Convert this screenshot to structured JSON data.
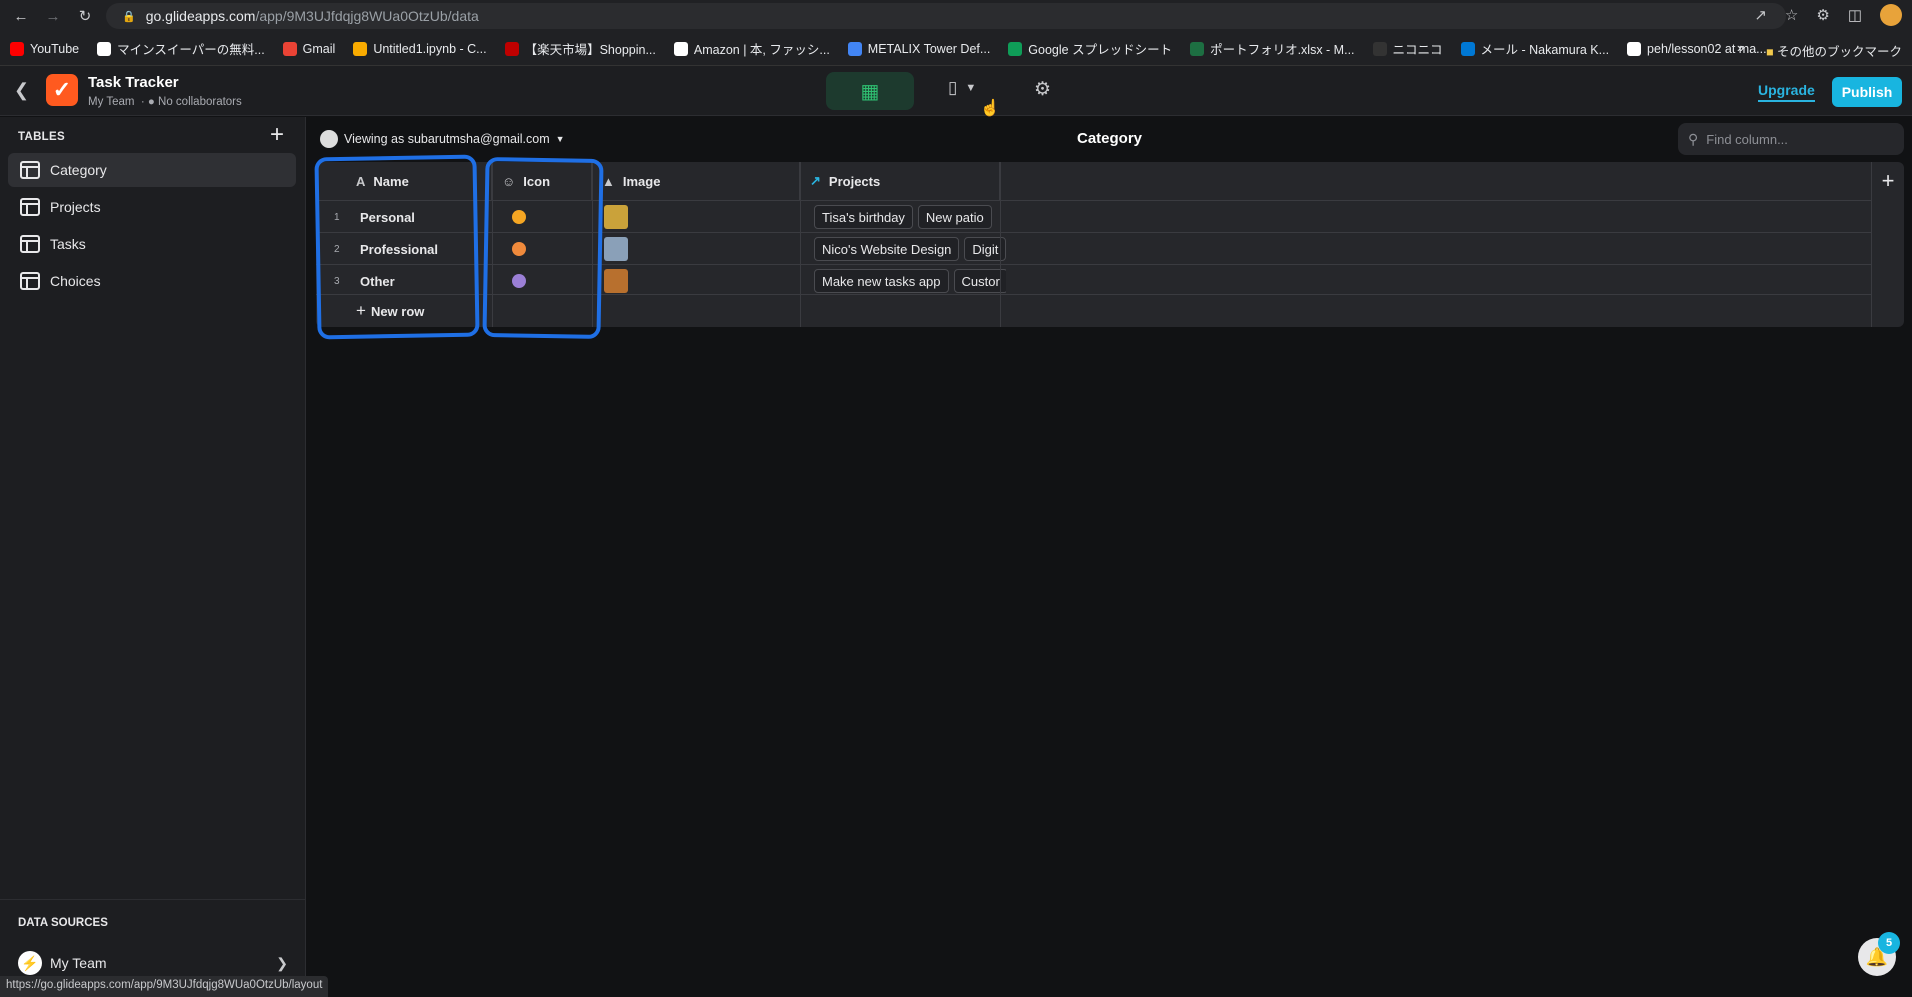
{
  "browser": {
    "url_host": "go.glideapps.com",
    "url_path": "/app/9M3UJfdqjg8WUa0OtzUb/data",
    "status_url": "https://go.glideapps.com/app/9M3UJfdqjg8WUa0OtzUb/layout"
  },
  "bookmarks": [
    {
      "label": "YouTube",
      "color": "#ff0000"
    },
    {
      "label": "マインスイーパーの無料...",
      "color": "#ffffff"
    },
    {
      "label": "Gmail",
      "color": "#ea4335"
    },
    {
      "label": "Untitled1.ipynb - C...",
      "color": "#f9ab00"
    },
    {
      "label": "【楽天市場】Shoppin...",
      "color": "#bf0000"
    },
    {
      "label": "Amazon | 本, ファッシ...",
      "color": "#ffffff"
    },
    {
      "label": "METALIX Tower Def...",
      "color": "#4285f4"
    },
    {
      "label": "Google スプレッドシート",
      "color": "#0f9d58"
    },
    {
      "label": "ポートフォリオ.xlsx - M...",
      "color": "#1d6f42"
    },
    {
      "label": "ニコニコ",
      "color": "#333333"
    },
    {
      "label": "メール - Nakamura K...",
      "color": "#0078d4"
    },
    {
      "label": "peh/lesson02 at ma...",
      "color": "#ffffff"
    }
  ],
  "bookmarks_overflow": "»",
  "bookmarks_other": "その他のブックマーク",
  "app": {
    "title": "Task Tracker",
    "team": "My Team",
    "collaborators": "No collaborators",
    "upgrade": "Upgrade",
    "publish": "Publish"
  },
  "sidebar": {
    "tables_heading": "TABLES",
    "items": [
      {
        "label": "Category",
        "active": true
      },
      {
        "label": "Projects",
        "active": false
      },
      {
        "label": "Tasks",
        "active": false
      },
      {
        "label": "Choices",
        "active": false
      }
    ],
    "data_sources_heading": "DATA SOURCES",
    "data_source": "My Team"
  },
  "main": {
    "viewing_as": "Viewing as subarutmsha@gmail.com",
    "table_title": "Category",
    "find_placeholder": "Find column..."
  },
  "table": {
    "columns": [
      "Name",
      "Icon",
      "Image",
      "Projects"
    ],
    "rows": [
      {
        "num": "1",
        "name": "Personal",
        "icon_color": "#f5a623",
        "image_color": "#caa23a",
        "projects": [
          "Tisa's birthday",
          "New patio"
        ]
      },
      {
        "num": "2",
        "name": "Professional",
        "icon_color": "#f08a3c",
        "image_color": "#8aa0b8",
        "projects": [
          "Nico's Website Design",
          "Digit"
        ]
      },
      {
        "num": "3",
        "name": "Other",
        "icon_color": "#9b7fd6",
        "image_color": "#b8702e",
        "projects": [
          "Make new tasks app",
          "Custor"
        ]
      }
    ],
    "new_row": "New row"
  },
  "notifications": {
    "count": "5"
  },
  "colors": {
    "accent": "#18b5e0",
    "highlight": "#1f6fe5",
    "data_mode": "#2fbf71",
    "logo": "#ff5a1f"
  }
}
